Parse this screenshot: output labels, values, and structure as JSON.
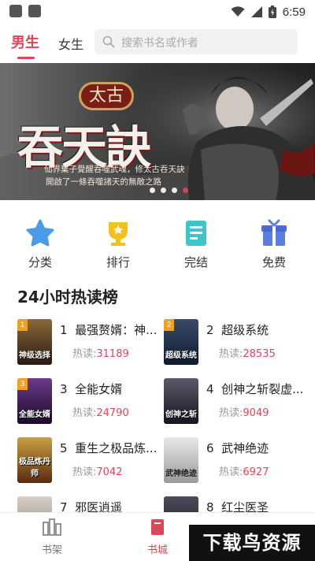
{
  "status_bar": {
    "time": "6:59"
  },
  "header": {
    "tabs": [
      {
        "label": "男生",
        "active": true
      },
      {
        "label": "女生",
        "active": false
      }
    ],
    "search_placeholder": "搜索书名或作者"
  },
  "banner": {
    "small_title": "太古",
    "big_title": "吞天訣",
    "subtitle_line1": "仙界棄子覺醒吞噬武魂，修太古吞天訣",
    "subtitle_line2": "開啟了一條吞噬諸天的無敵之路",
    "dot_count": 4,
    "active_dot": 4
  },
  "menu": {
    "items": [
      {
        "label": "分类",
        "icon": "star-icon",
        "color": "#4a9ce8"
      },
      {
        "label": "排行",
        "icon": "trophy-icon",
        "color": "#f2c21b"
      },
      {
        "label": "完结",
        "icon": "book-icon",
        "color": "#3cc6c8"
      },
      {
        "label": "免费",
        "icon": "gift-icon",
        "color": "#5b7fe0"
      }
    ]
  },
  "section": {
    "title": "24小时热读榜"
  },
  "rank_list": [
    {
      "rank": "1",
      "title": "最强赘婿：神...",
      "heat_label": "热读:",
      "heat_value": "31189",
      "cover_text": "神级选择",
      "badge_color": "#f0a020"
    },
    {
      "rank": "2",
      "title": "超级系统",
      "heat_label": "热读:",
      "heat_value": "28535",
      "cover_text": "超级系统",
      "badge_color": "#f0a020"
    },
    {
      "rank": "3",
      "title": "全能女婿",
      "heat_label": "热读:",
      "heat_value": "24790",
      "cover_text": "全能女婿",
      "badge_color": "#f0a020"
    },
    {
      "rank": "4",
      "title": "创神之斩裂虚...",
      "heat_label": "热读:",
      "heat_value": "9049",
      "cover_text": "创神之斩",
      "badge_color": ""
    },
    {
      "rank": "5",
      "title": "重生之极品炼...",
      "heat_label": "热读:",
      "heat_value": "7042",
      "cover_text": "极品炼丹师",
      "badge_color": ""
    },
    {
      "rank": "6",
      "title": "武神绝迹",
      "heat_label": "热读:",
      "heat_value": "6927",
      "cover_text": "武神绝迹",
      "badge_color": ""
    },
    {
      "rank": "7",
      "title": "邪医逍遥",
      "heat_label": "",
      "heat_value": "",
      "cover_text": "",
      "badge_color": ""
    },
    {
      "rank": "8",
      "title": "红尘医圣",
      "heat_label": "",
      "heat_value": "",
      "cover_text": "",
      "badge_color": ""
    }
  ],
  "bottom_nav": {
    "items": [
      {
        "label": "书架",
        "active": false
      },
      {
        "label": "书城",
        "active": true
      }
    ]
  },
  "watermark": "下载鸟资源",
  "colors": {
    "accent": "#e0455a"
  }
}
